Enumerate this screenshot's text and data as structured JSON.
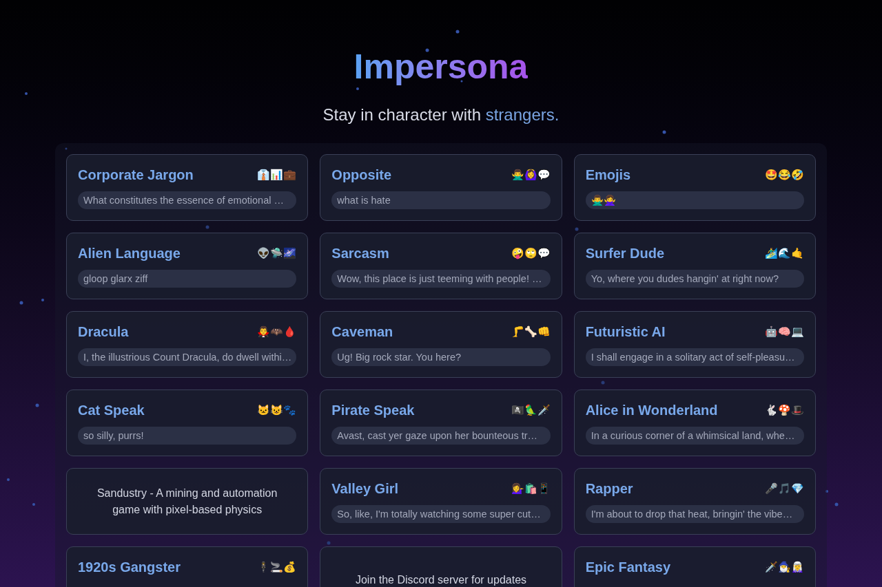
{
  "header": {
    "title": "Impersona",
    "subtitle": {
      "text": "Stay in character with",
      "highlight": "strangers."
    }
  },
  "cards": [
    {
      "kind": "persona",
      "title": "Corporate Jargon",
      "emojis": "👔📊💼",
      "message": "What constitutes the essence of emotional …"
    },
    {
      "kind": "persona",
      "title": "Alien Language",
      "emojis": "👽🛸🌌",
      "message": "gloop glarx ziff"
    },
    {
      "kind": "persona",
      "title": "Dracula",
      "emojis": "🧛‍♂️🦇🩸",
      "message": "I, the illustrious Count Dracula, do dwell withi…"
    },
    {
      "kind": "persona",
      "title": "Cat Speak",
      "emojis": "🐱😺🐾",
      "message": "so silly, purrs!"
    },
    {
      "kind": "promo",
      "text": "Sandustry - A mining and automation game with pixel-based physics"
    },
    {
      "kind": "persona",
      "title": "1920s Gangster",
      "emojis": "🕴️🚬💰"
    },
    {
      "kind": "persona",
      "title": "Opposite",
      "emojis": "🙅‍♂️🙆‍♀️💬",
      "message": "what is hate"
    },
    {
      "kind": "persona",
      "title": "Sarcasm",
      "emojis": "🤪🙄💬",
      "message": "Wow, this place is just teeming with people! …"
    },
    {
      "kind": "persona",
      "title": "Caveman",
      "emojis": "🦵🦴👊",
      "message": "Ug! Big rock star. You here?"
    },
    {
      "kind": "persona",
      "title": "Pirate Speak",
      "emojis": "🏴‍☠️🦜🗡️",
      "message": "Avast, cast yer gaze upon her bounteous tr…"
    },
    {
      "kind": "persona",
      "title": "Valley Girl",
      "emojis": "💁‍♀️🛍️📱",
      "message": "So, like, I'm totally watching some super cut…"
    },
    {
      "kind": "promo",
      "text": "Join the Discord server for updates"
    },
    {
      "kind": "persona",
      "title": "Emojis",
      "emojis": "🤩😂🤣",
      "message": "🙅‍♂️🙅‍♀️"
    },
    {
      "kind": "persona",
      "title": "Surfer Dude",
      "emojis": "🏄‍♂️🌊🤙",
      "message": "Yo, where you dudes hangin' at right now?"
    },
    {
      "kind": "persona",
      "title": "Futuristic AI",
      "emojis": "🤖🧠💻",
      "message": "I shall engage in a solitary act of self-pleasu…"
    },
    {
      "kind": "persona",
      "title": "Alice in Wonderland",
      "emojis": "🐇🍄🎩",
      "message": "In a curious corner of a whimsical land, whe…"
    },
    {
      "kind": "persona",
      "title": "Rapper",
      "emojis": "🎤🎵💎",
      "message": "I'm about to drop that heat, bringin' the vibe…"
    },
    {
      "kind": "persona",
      "title": "Epic Fantasy",
      "emojis": "🗡️🧙‍♂️🧝‍♀️"
    }
  ]
}
